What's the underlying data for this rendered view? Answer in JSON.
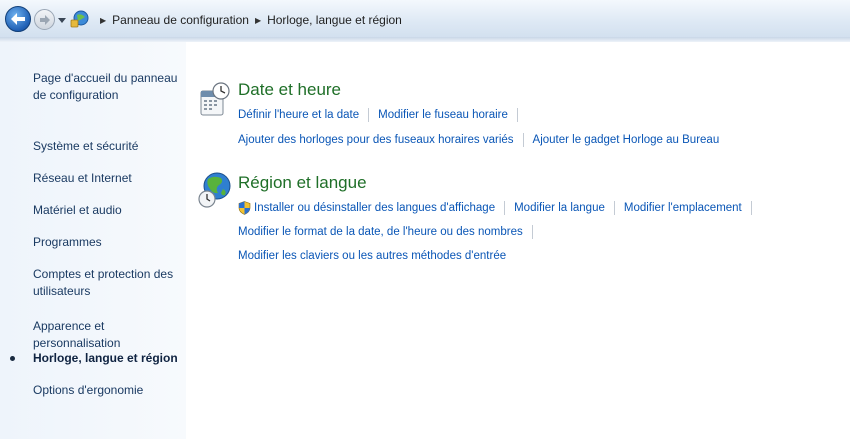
{
  "address_bar": {
    "breadcrumb": [
      "Panneau de configuration",
      "Horloge, langue et région"
    ]
  },
  "sidebar": {
    "items": [
      {
        "label": "Page d'accueil du panneau de configuration"
      },
      {
        "label": "Système et sécurité"
      },
      {
        "label": "Réseau et Internet"
      },
      {
        "label": "Matériel et audio"
      },
      {
        "label": "Programmes"
      },
      {
        "label": "Comptes et protection des utilisateurs"
      },
      {
        "label": "Apparence et personnalisation"
      },
      {
        "label": "Horloge, langue et région",
        "active": true
      },
      {
        "label": "Options d'ergonomie"
      }
    ]
  },
  "categories": {
    "date_time": {
      "title": "Date et heure",
      "links": [
        "Définir l'heure et la date",
        "Modifier le fuseau horaire",
        "Ajouter des horloges pour des fuseaux horaires variés",
        "Ajouter le gadget Horloge au Bureau"
      ]
    },
    "region_language": {
      "title": "Région et langue",
      "links": [
        "Installer ou désinstaller des langues d'affichage",
        "Modifier la langue",
        "Modifier l'emplacement",
        "Modifier le format de la date, de l'heure ou des nombres",
        "Modifier les claviers ou les autres méthodes d'entrée"
      ]
    }
  },
  "icons": {
    "back": "back-arrow-icon",
    "forward": "forward-arrow-icon",
    "history": "history-dropdown-icon",
    "control_panel": "control-panel-icon",
    "date_time": "calendar-clock-icon",
    "region_language": "globe-clock-icon",
    "uac": "uac-shield-icon"
  },
  "colors": {
    "category_title": "#1f6f28",
    "link": "#0a56b6",
    "sidebar_text": "#1a3a62"
  }
}
